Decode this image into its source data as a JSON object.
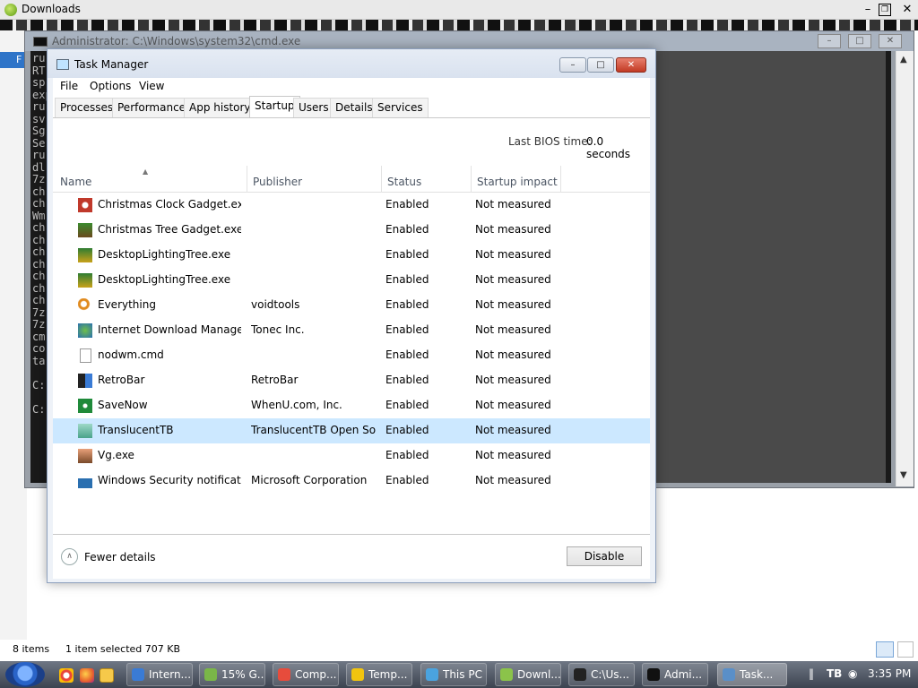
{
  "explorer": {
    "title": "Downloads",
    "blue_label": "F",
    "status": {
      "items": "8 items",
      "selection": "1 item selected  707 KB"
    }
  },
  "cmd": {
    "title": "Administrator: C:\\Windows\\system32\\cmd.exe",
    "lines": "ru\nRT\nsp\nexp\nru\nsv\nSg\nSe\nru\ndl\n7z\nch\nch\nWm\nch\nch\nch\nch\nch\nch\nch\n7z\n7z\ncm\nco\nta\n\nC:\n\nC:",
    "ghost": {
      "a": "",
      "b": "",
      "c": ""
    }
  },
  "task_manager": {
    "title": "Task Manager",
    "menu": [
      "File",
      "Options",
      "View"
    ],
    "tabs": [
      "Processes",
      "Performance",
      "App history",
      "Startup",
      "Users",
      "Details",
      "Services"
    ],
    "active_tab": "Startup",
    "bios_label": "Last BIOS time:",
    "bios_value": "0.0 seconds",
    "columns": {
      "name": "Name",
      "publisher": "Publisher",
      "status": "Status",
      "impact": "Startup impact"
    },
    "rows": [
      {
        "name": "Christmas Clock Gadget.exe",
        "publisher": "",
        "status": "Enabled",
        "impact": "Not measured",
        "icon": "clock-gadget-icon"
      },
      {
        "name": "Christmas Tree Gadget.exe",
        "publisher": "",
        "status": "Enabled",
        "impact": "Not measured",
        "icon": "tree-gadget-icon"
      },
      {
        "name": "DesktopLightingTree.exe",
        "publisher": "",
        "status": "Enabled",
        "impact": "Not measured",
        "icon": "lighting-tree-icon"
      },
      {
        "name": "DesktopLightingTree.exe",
        "publisher": "",
        "status": "Enabled",
        "impact": "Not measured",
        "icon": "lighting-tree-icon"
      },
      {
        "name": "Everything",
        "publisher": "voidtools",
        "status": "Enabled",
        "impact": "Not measured",
        "icon": "magnifier-icon"
      },
      {
        "name": "Internet Download Manager...",
        "publisher": "Tonec Inc.",
        "status": "Enabled",
        "impact": "Not measured",
        "icon": "idm-globe-icon"
      },
      {
        "name": "nodwm.cmd",
        "publisher": "",
        "status": "Enabled",
        "impact": "Not measured",
        "icon": "blank-file-icon"
      },
      {
        "name": "RetroBar",
        "publisher": "RetroBar",
        "status": "Enabled",
        "impact": "Not measured",
        "icon": "retrobar-icon"
      },
      {
        "name": "SaveNow",
        "publisher": "WhenU.com, Inc.",
        "status": "Enabled",
        "impact": "Not measured",
        "icon": "dollar-icon"
      },
      {
        "name": "TranslucentTB",
        "publisher": "TranslucentTB Open Sou...",
        "status": "Enabled",
        "impact": "Not measured",
        "icon": "translucenttb-icon"
      },
      {
        "name": "Vg.exe",
        "publisher": "",
        "status": "Enabled",
        "impact": "Not measured",
        "icon": "vg-icon"
      },
      {
        "name": "Windows Security notificati...",
        "publisher": "Microsoft Corporation",
        "status": "Enabled",
        "impact": "Not measured",
        "icon": "security-icon"
      }
    ],
    "selected_row": 9,
    "fewer_details": "Fewer details",
    "disable": "Disable"
  },
  "taskbar": {
    "buttons": [
      "Intern...",
      "15% G...",
      "Comp...",
      "Temp...",
      "This PC",
      "Downl...",
      "C:\\Us...",
      "Admi...",
      "Task..."
    ],
    "active": "Task...",
    "clock": "3:35 PM"
  }
}
